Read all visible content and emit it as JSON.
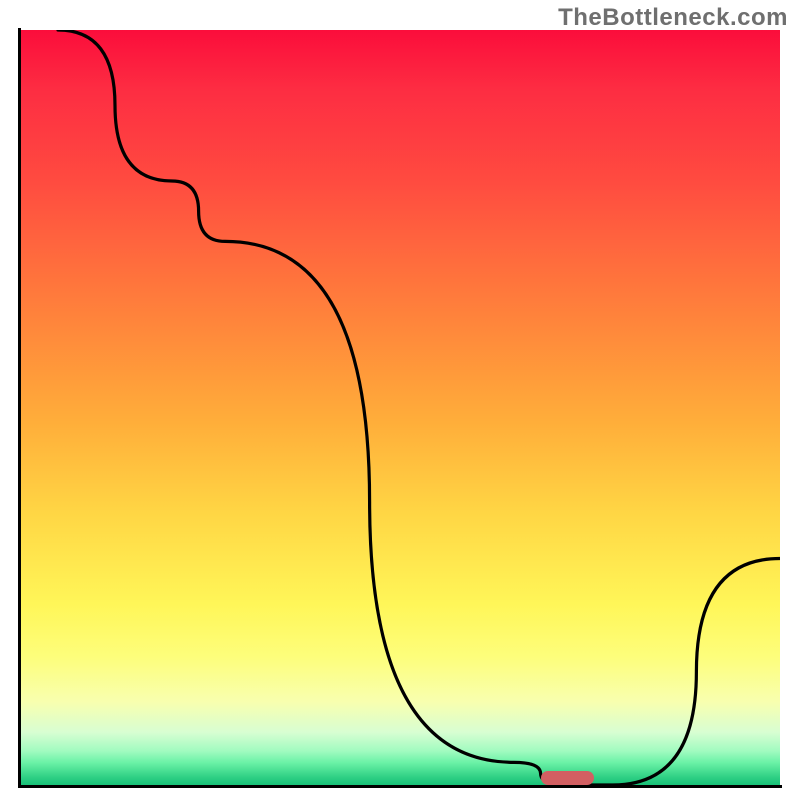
{
  "watermark": "TheBottleneck.com",
  "colors": {
    "curve": "#000000",
    "marker": "#d25f62",
    "axis": "#000000"
  },
  "chart_data": {
    "type": "line",
    "title": "",
    "xlabel": "",
    "ylabel": "",
    "xlim": [
      0,
      100
    ],
    "ylim": [
      0,
      100
    ],
    "x": [
      5,
      20,
      27,
      65,
      72,
      78,
      100
    ],
    "values": [
      100,
      80,
      72,
      3,
      0,
      0,
      30
    ],
    "curvature_note": "piecewise with slight curvature; steeper drop after x≈27, flat trough around x≈70–78, rise after",
    "marker": {
      "x_center": 72,
      "width": 7,
      "y": 0
    },
    "background_gradient_stops": [
      {
        "pos": 0,
        "color": "#fb0d3b"
      },
      {
        "pos": 0.2,
        "color": "#ff4b40"
      },
      {
        "pos": 0.52,
        "color": "#ffae3a"
      },
      {
        "pos": 0.76,
        "color": "#fff658"
      },
      {
        "pos": 0.93,
        "color": "#d8fed2"
      },
      {
        "pos": 1.0,
        "color": "#17c178"
      }
    ]
  }
}
